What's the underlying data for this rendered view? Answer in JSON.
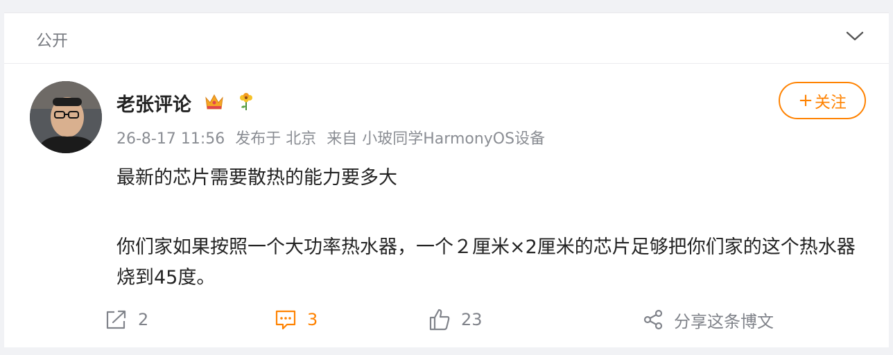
{
  "visibility": {
    "label": "公开",
    "icon": "chevron-down-icon"
  },
  "post": {
    "author": "老张评论",
    "badges": [
      "crown-icon",
      "flower-icon"
    ],
    "meta": {
      "datetime": "26-8-17 11:56",
      "published_label": "发布于 北京",
      "source": "来自 小玻同学HarmonyOS设备"
    },
    "follow_label": "关注",
    "content": [
      "最新的芯片需要散热的能力要多大",
      "你们家如果按照一个大功率热水器，一个２厘米×2厘米的芯片足够把你们家的这个热水器烧到45度。"
    ]
  },
  "actions": {
    "repost": {
      "icon": "repost-icon",
      "count": "2"
    },
    "comment": {
      "icon": "comment-icon",
      "count": "3"
    },
    "like": {
      "icon": "thumbs-up-icon",
      "count": "23"
    },
    "share": {
      "icon": "share-icon",
      "label": "分享这条博文"
    }
  },
  "colors": {
    "accent": "#ff8200",
    "text": "#222222",
    "meta": "#8a8d93"
  }
}
